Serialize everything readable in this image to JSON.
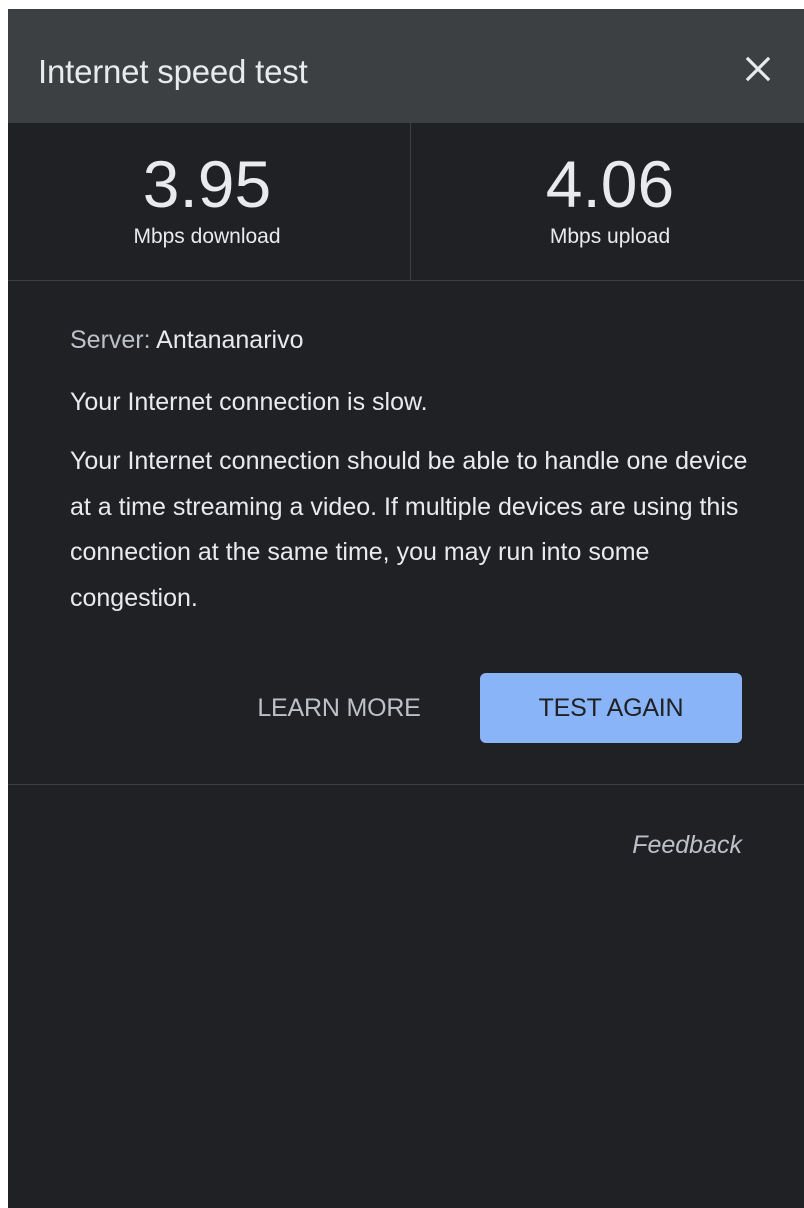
{
  "header": {
    "title": "Internet speed test",
    "close_icon": "close-icon"
  },
  "results": {
    "download": {
      "value": "3.95",
      "label": "Mbps download"
    },
    "upload": {
      "value": "4.06",
      "label": "Mbps upload"
    }
  },
  "details": {
    "server_label": "Server:",
    "server_value": "Antananarivo",
    "status": "Your Internet connection is slow.",
    "description": "Your Internet connection should be able to handle one device at a time streaming a video. If multiple devices are using this connection at the same time, you may run into some congestion."
  },
  "actions": {
    "learn_more": "LEARN MORE",
    "test_again": "TEST AGAIN"
  },
  "footer": {
    "feedback": "Feedback"
  },
  "colors": {
    "panel_bg": "#202124",
    "header_bg": "#3c4043",
    "text_primary": "#e8eaed",
    "text_secondary": "#bdc1c6",
    "accent_button": "#8ab4f8"
  }
}
